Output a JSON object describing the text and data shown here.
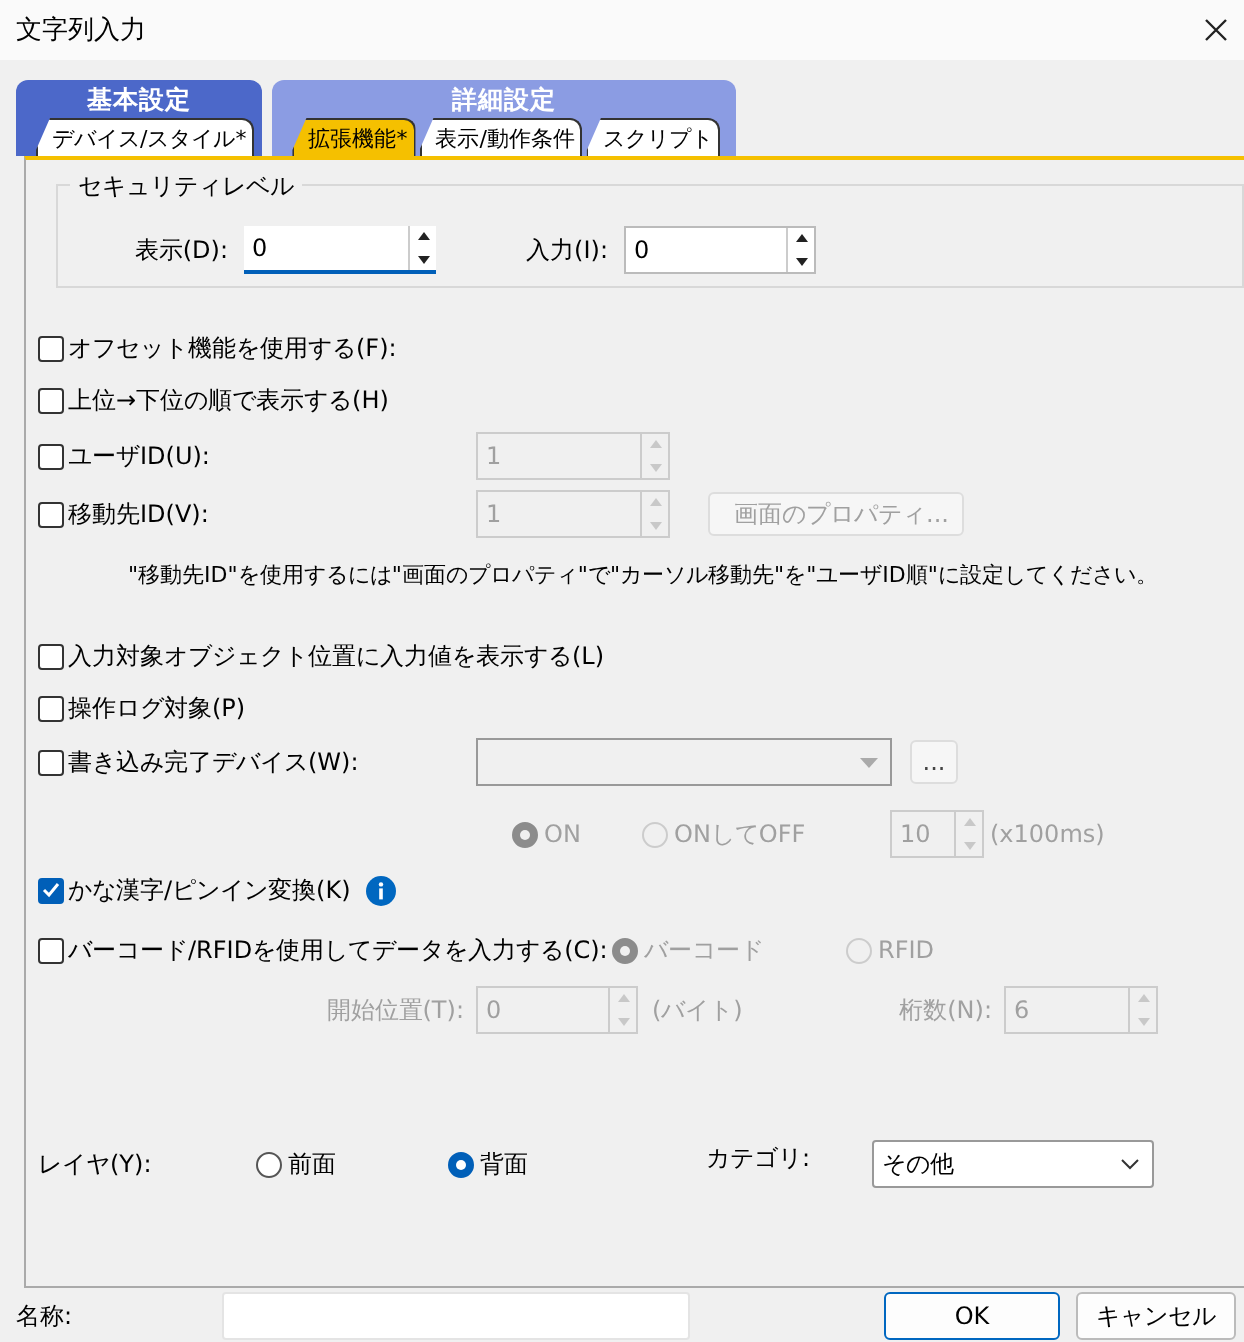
{
  "window": {
    "title": "文字列入力"
  },
  "tab_groups": [
    {
      "label": "基本設定",
      "selected": false,
      "tabs": [
        {
          "label": "デバイス/スタイル*",
          "selected": false
        }
      ]
    },
    {
      "label": "詳細設定",
      "selected": true,
      "tabs": [
        {
          "label": "拡張機能*",
          "selected": true
        },
        {
          "label": "表示/動作条件",
          "selected": false
        },
        {
          "label": "スクリプト",
          "selected": false
        }
      ]
    }
  ],
  "security_level": {
    "title": "セキュリティレベル",
    "fields": [
      {
        "label": "表示(D):",
        "value": "0",
        "focused": true
      },
      {
        "label": "入力(I):",
        "value": "0",
        "focused": false
      }
    ]
  },
  "options": [
    {
      "kind": "check",
      "label": "オフセット機能を使用する(F):",
      "checked": false
    },
    {
      "kind": "check",
      "label": "上位→下位の順で表示する(H)",
      "checked": false
    },
    {
      "kind": "check_spin",
      "label": "ユーザID(U):",
      "checked": false,
      "value": "1",
      "disabled": true
    },
    {
      "kind": "check_spin",
      "label": "移動先ID(V):",
      "checked": false,
      "value": "1",
      "disabled": true,
      "button": "画面のプロパティ..."
    },
    {
      "kind": "note",
      "text": "\"移動先ID\"を使用するには\"画面のプロパティ\"で\"カーソル移動先\"を\"ユーザID順\"に設定してください。"
    },
    {
      "kind": "check",
      "label": "入力対象オブジェクト位置に入力値を表示する(L)",
      "checked": false
    },
    {
      "kind": "check",
      "label": "操作ログ対象(P)",
      "checked": false
    },
    {
      "kind": "check_combo",
      "label": "書き込み完了デバイス(W):",
      "checked": false,
      "disabled": true,
      "button": "..."
    },
    {
      "kind": "radios",
      "disabled": true,
      "choices": [
        {
          "label": "ON",
          "selected": true
        },
        {
          "label": "ONしてOFF",
          "selected": false
        }
      ],
      "value": "10",
      "unit": "(x100ms)"
    },
    {
      "kind": "check_info",
      "label": "かな漢字/ピンイン変換(K)",
      "checked": true
    },
    {
      "kind": "check_radios",
      "label": "バーコード/RFIDを使用してデータを入力する(C):",
      "checked": false,
      "disabled": true,
      "choices": [
        {
          "label": "バーコード",
          "selected": true
        },
        {
          "label": "RFID",
          "selected": false
        }
      ]
    },
    {
      "kind": "spin_pair",
      "disabled": true,
      "fields": [
        {
          "label": "開始位置(T):",
          "value": "0",
          "unit": "(バイト)"
        },
        {
          "label": "桁数(N):",
          "value": "6"
        }
      ]
    }
  ],
  "layer": {
    "label": "レイヤ(Y):",
    "choices": [
      {
        "label": "前面",
        "selected": false
      },
      {
        "label": "背面",
        "selected": true
      }
    ]
  },
  "category": {
    "label": "カテゴリ:",
    "value": "その他"
  },
  "name_field": {
    "label": "名称:"
  },
  "buttons": [
    {
      "label": "OK",
      "default": true
    },
    {
      "label": "キャンセル",
      "default": false
    }
  ]
}
